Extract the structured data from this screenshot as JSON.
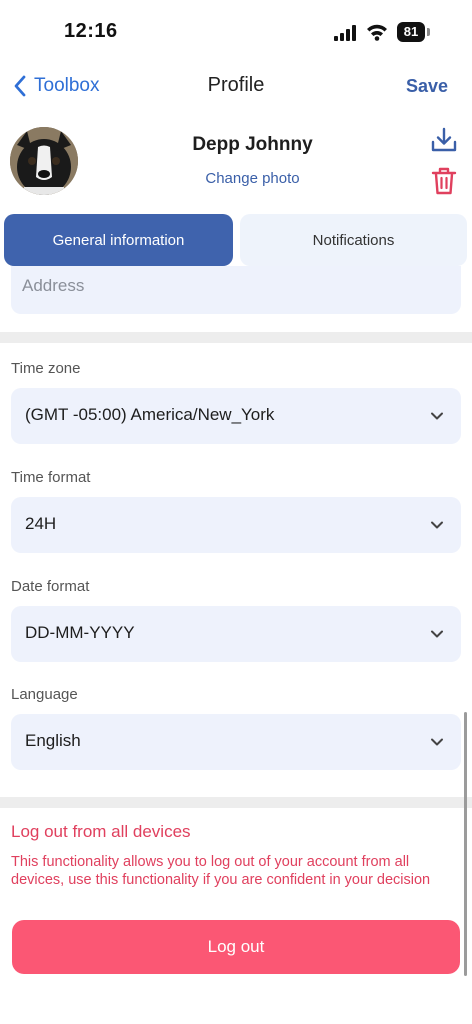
{
  "status_bar": {
    "time": "12:16",
    "battery": "81"
  },
  "nav": {
    "back_label": "Toolbox",
    "title": "Profile",
    "save_label": "Save"
  },
  "profile": {
    "name": "Depp Johnny",
    "change_photo": "Change photo"
  },
  "tabs": [
    {
      "label": "General information",
      "active": true
    },
    {
      "label": "Notifications",
      "active": false
    }
  ],
  "address": {
    "placeholder": "Address"
  },
  "settings": {
    "time_zone": {
      "label": "Time zone",
      "value": "(GMT -05:00) America/New_York"
    },
    "time_format": {
      "label": "Time format",
      "value": "24H"
    },
    "date_format": {
      "label": "Date format",
      "value": "DD-MM-YYYY"
    },
    "language": {
      "label": "Language",
      "value": "English"
    }
  },
  "logout": {
    "heading": "Log out from all devices",
    "description": "This functionality allows you to log out of your account from all devices, use this functionality if you are confident in your decision",
    "button_label": "Log out"
  },
  "colors": {
    "accent": "#3f63ad",
    "link": "#2f6fd6",
    "danger": "#fb5774",
    "field_bg": "#eef2fc"
  },
  "icons": [
    "chevron-left-icon",
    "download-icon",
    "trash-icon",
    "chevron-down-icon",
    "wifi-icon",
    "signal-icon"
  ]
}
